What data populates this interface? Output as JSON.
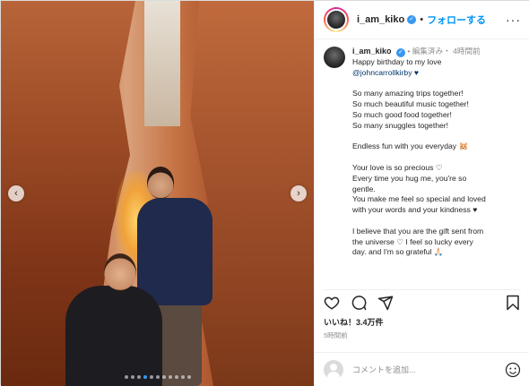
{
  "post": {
    "carousel": {
      "slides": 11,
      "active_index": 3
    }
  },
  "header": {
    "username": "i_am_kiko",
    "separator": "•",
    "follow_label": "フォローする",
    "more_label": "···"
  },
  "caption": {
    "username": "i_am_kiko",
    "meta": "• 編集済み・ 4時間前",
    "lines": [
      "Happy birthday to my love",
      "@johncarrollkirby ♥",
      "",
      "So many amazing trips together!",
      "So much beautiful music together!",
      "So much good food together!",
      "So many snuggles together!",
      "",
      "Endless fun with you everyday 🐹",
      "",
      "Your love is so precious ♡",
      "Every time you hug me, you're so",
      "gentle.",
      "You make me feel so special and loved",
      "with your words and your kindness ♥",
      "",
      "I believe that you are the gift sent from",
      "the universe ♡ I feel so lucky every",
      "day. and I'm so grateful 🙏🏻"
    ]
  },
  "engagement": {
    "likes": "いいね！3.4万件",
    "timestamp": "5時間前"
  },
  "comment": {
    "placeholder": "コメントを追加..."
  },
  "icons": {
    "like": "heart-icon",
    "comment": "comment-icon",
    "share": "share-icon",
    "save": "bookmark-icon",
    "emoji": "emoji-icon"
  },
  "colors": {
    "link": "#0095f6",
    "mention": "#00376b",
    "muted": "#8e8e8e",
    "verified": "#3897f0"
  }
}
